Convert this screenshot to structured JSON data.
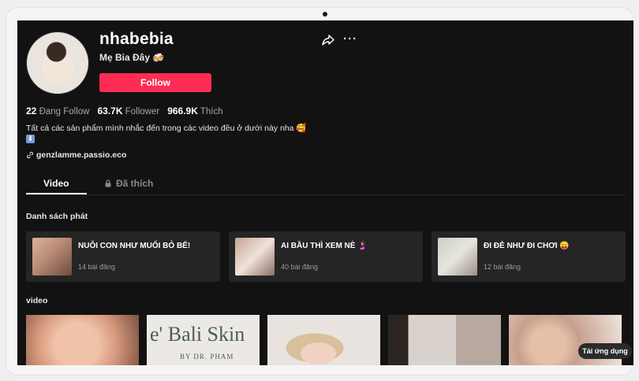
{
  "profile": {
    "username": "nhabebia",
    "nickname": "Mẹ Bia Đây 🍻",
    "follow_label": "Follow"
  },
  "stats": [
    {
      "value": "22",
      "label": "Đang Follow"
    },
    {
      "value": "63.7K",
      "label": "Follower"
    },
    {
      "value": "966.9K",
      "label": "Thích"
    }
  ],
  "bio": "Tất cả các sản phẩm mình nhắc đến trong các video đều ở dưới này nha 🥰",
  "bio_icon": "⬇",
  "link": "genzlamme.passio.eco",
  "tabs": {
    "video": "Video",
    "liked": "Đã thích"
  },
  "sections": {
    "playlists": "Danh sách phát",
    "videos": "video"
  },
  "playlists": [
    {
      "title": "NUÔI CON NHƯ MUỐI BỎ BỂ!",
      "count": "14 bài đăng"
    },
    {
      "title": "AI BẦU THÌ XEM NÈ 🤰",
      "count": "40 bài đăng"
    },
    {
      "title": "ĐI ĐẺ NHƯ ĐI CHƠI 😛",
      "count": "12 bài đăng"
    }
  ],
  "video_texts": {
    "bali": "e' Bali Skin",
    "bali_sub": "BY DR. PHAM"
  },
  "app_button": "Tải ứng dụng",
  "colors": {
    "accent": "#fe2c55",
    "background": "#121212",
    "card": "#252525"
  }
}
